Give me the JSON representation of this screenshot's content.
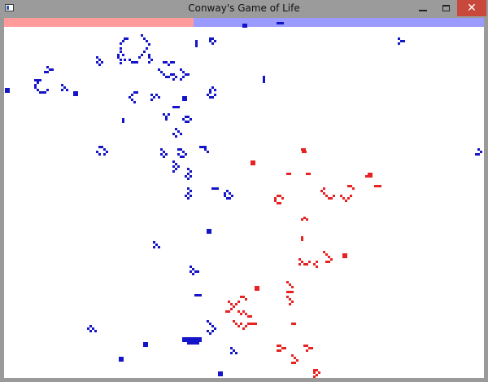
{
  "window": {
    "title": "Conway's Game of Life",
    "icon": "app-icon",
    "controls": [
      "minimize-icon",
      "maximize-icon",
      "close-icon"
    ]
  },
  "colors": {
    "red_team": "#e62222",
    "blue_team": "#1414c8",
    "red_bar": "#ff9b9b",
    "blue_bar": "#9b9bff",
    "background": "#ffffff",
    "titlebar": "#9b9b9b",
    "close_button": "#c9483c"
  },
  "population": {
    "red_fraction": 0.395,
    "blue_fraction": 0.605
  },
  "board": {
    "cell_size": 3,
    "red_cells": [
      [
        370,
        182
      ],
      [
        373,
        182
      ],
      [
        371,
        185
      ],
      [
        374,
        185
      ],
      [
        308,
        197
      ],
      [
        311,
        197
      ],
      [
        308,
        200
      ],
      [
        311,
        200
      ],
      [
        352,
        212
      ],
      [
        355,
        212
      ],
      [
        376,
        212
      ],
      [
        379,
        212
      ],
      [
        452,
        212
      ],
      [
        455,
        212
      ],
      [
        449,
        215
      ],
      [
        452,
        215
      ],
      [
        455,
        215
      ],
      [
        427,
        227
      ],
      [
        430,
        227
      ],
      [
        433,
        230
      ],
      [
        460,
        227
      ],
      [
        463,
        227
      ],
      [
        466,
        227
      ],
      [
        397,
        230
      ],
      [
        394,
        233
      ],
      [
        397,
        236
      ],
      [
        400,
        239
      ],
      [
        403,
        242
      ],
      [
        406,
        242
      ],
      [
        409,
        239
      ],
      [
        418,
        239
      ],
      [
        421,
        242
      ],
      [
        424,
        245
      ],
      [
        427,
        242
      ],
      [
        430,
        239
      ],
      [
        337,
        242
      ],
      [
        340,
        239
      ],
      [
        343,
        239
      ],
      [
        346,
        242
      ],
      [
        343,
        248
      ],
      [
        340,
        248
      ],
      [
        337,
        245
      ],
      [
        370,
        268
      ],
      [
        373,
        266
      ],
      [
        376,
        268
      ],
      [
        370,
        290
      ],
      [
        370,
        293
      ],
      [
        397,
        308
      ],
      [
        400,
        311
      ],
      [
        403,
        314
      ],
      [
        406,
        317
      ],
      [
        403,
        320
      ],
      [
        400,
        320
      ],
      [
        421,
        311
      ],
      [
        424,
        311
      ],
      [
        421,
        314
      ],
      [
        424,
        314
      ],
      [
        367,
        317
      ],
      [
        370,
        320
      ],
      [
        367,
        323
      ],
      [
        373,
        323
      ],
      [
        376,
        323
      ],
      [
        379,
        320
      ],
      [
        388,
        320
      ],
      [
        385,
        323
      ],
      [
        388,
        326
      ],
      [
        313,
        351
      ],
      [
        316,
        351
      ],
      [
        313,
        354
      ],
      [
        316,
        354
      ],
      [
        352,
        345
      ],
      [
        355,
        348
      ],
      [
        358,
        351
      ],
      [
        352,
        357
      ],
      [
        355,
        357
      ],
      [
        358,
        357
      ],
      [
        352,
        363
      ],
      [
        355,
        366
      ],
      [
        358,
        369
      ],
      [
        355,
        372
      ],
      [
        295,
        363
      ],
      [
        298,
        363
      ],
      [
        301,
        366
      ],
      [
        280,
        369
      ],
      [
        283,
        372
      ],
      [
        286,
        375
      ],
      [
        289,
        372
      ],
      [
        292,
        369
      ],
      [
        283,
        378
      ],
      [
        277,
        381
      ],
      [
        280,
        381
      ],
      [
        292,
        381
      ],
      [
        295,
        384
      ],
      [
        298,
        381
      ],
      [
        301,
        384
      ],
      [
        304,
        387
      ],
      [
        307,
        387
      ],
      [
        286,
        393
      ],
      [
        289,
        396
      ],
      [
        292,
        399
      ],
      [
        295,
        396
      ],
      [
        298,
        402
      ],
      [
        301,
        399
      ],
      [
        304,
        396
      ],
      [
        307,
        396
      ],
      [
        310,
        396
      ],
      [
        313,
        396
      ],
      [
        358,
        396
      ],
      [
        361,
        396
      ],
      [
        340,
        423
      ],
      [
        343,
        423
      ],
      [
        346,
        426
      ],
      [
        349,
        426
      ],
      [
        343,
        429
      ],
      [
        340,
        429
      ],
      [
        373,
        423
      ],
      [
        376,
        423
      ],
      [
        379,
        426
      ],
      [
        382,
        426
      ],
      [
        376,
        429
      ],
      [
        358,
        435
      ],
      [
        361,
        438
      ],
      [
        364,
        441
      ],
      [
        361,
        444
      ],
      [
        358,
        444
      ],
      [
        385,
        453
      ],
      [
        388,
        453
      ],
      [
        385,
        456
      ],
      [
        388,
        459
      ],
      [
        391,
        456
      ],
      [
        385,
        461
      ]
    ],
    "blue_cells": [
      [
        298,
        29
      ],
      [
        301,
        29
      ],
      [
        298,
        31
      ],
      [
        301,
        31
      ],
      [
        340,
        27
      ],
      [
        343,
        27
      ],
      [
        346,
        27
      ],
      [
        489,
        46
      ],
      [
        492,
        49
      ],
      [
        495,
        49
      ],
      [
        489,
        52
      ],
      [
        257,
        46
      ],
      [
        260,
        46
      ],
      [
        263,
        49
      ],
      [
        257,
        49
      ],
      [
        260,
        52
      ],
      [
        240,
        49
      ],
      [
        240,
        52
      ],
      [
        240,
        55
      ],
      [
        173,
        42
      ],
      [
        176,
        46
      ],
      [
        179,
        49
      ],
      [
        182,
        53
      ],
      [
        179,
        58
      ],
      [
        176,
        62
      ],
      [
        173,
        66
      ],
      [
        170,
        69
      ],
      [
        152,
        46
      ],
      [
        155,
        46
      ],
      [
        150,
        49
      ],
      [
        147,
        52
      ],
      [
        147,
        58
      ],
      [
        147,
        62
      ],
      [
        150,
        66
      ],
      [
        147,
        72
      ],
      [
        152,
        72
      ],
      [
        158,
        72
      ],
      [
        161,
        75
      ],
      [
        164,
        75
      ],
      [
        167,
        75
      ],
      [
        144,
        66
      ],
      [
        144,
        69
      ],
      [
        147,
        76
      ],
      [
        182,
        66
      ],
      [
        182,
        69
      ],
      [
        182,
        75
      ],
      [
        185,
        72
      ],
      [
        118,
        69
      ],
      [
        121,
        72
      ],
      [
        124,
        75
      ],
      [
        121,
        78
      ],
      [
        118,
        75
      ],
      [
        200,
        75
      ],
      [
        203,
        75
      ],
      [
        206,
        78
      ],
      [
        209,
        75
      ],
      [
        212,
        75
      ],
      [
        194,
        84
      ],
      [
        197,
        87
      ],
      [
        200,
        90
      ],
      [
        203,
        93
      ],
      [
        206,
        93
      ],
      [
        209,
        90
      ],
      [
        212,
        90
      ],
      [
        215,
        93
      ],
      [
        212,
        96
      ],
      [
        221,
        84
      ],
      [
        224,
        87
      ],
      [
        227,
        90
      ],
      [
        224,
        93
      ],
      [
        221,
        96
      ],
      [
        230,
        90
      ],
      [
        57,
        81
      ],
      [
        60,
        84
      ],
      [
        63,
        84
      ],
      [
        57,
        87
      ],
      [
        54,
        87
      ],
      [
        6,
        108
      ],
      [
        9,
        108
      ],
      [
        6,
        111
      ],
      [
        9,
        111
      ],
      [
        42,
        97
      ],
      [
        45,
        97
      ],
      [
        48,
        97
      ],
      [
        45,
        100
      ],
      [
        42,
        103
      ],
      [
        42,
        106
      ],
      [
        45,
        109
      ],
      [
        48,
        112
      ],
      [
        51,
        112
      ],
      [
        54,
        112
      ],
      [
        57,
        109
      ],
      [
        75,
        103
      ],
      [
        78,
        106
      ],
      [
        81,
        109
      ],
      [
        75,
        109
      ],
      [
        90,
        112
      ],
      [
        93,
        112
      ],
      [
        90,
        115
      ],
      [
        93,
        115
      ],
      [
        323,
        93
      ],
      [
        323,
        96
      ],
      [
        323,
        99
      ],
      [
        257,
        109
      ],
      [
        260,
        106
      ],
      [
        263,
        109
      ],
      [
        257,
        112
      ],
      [
        254,
        115
      ],
      [
        257,
        118
      ],
      [
        260,
        118
      ],
      [
        263,
        115
      ],
      [
        164,
        112
      ],
      [
        167,
        112
      ],
      [
        161,
        115
      ],
      [
        158,
        118
      ],
      [
        161,
        121
      ],
      [
        164,
        124
      ],
      [
        185,
        115
      ],
      [
        188,
        118
      ],
      [
        191,
        115
      ],
      [
        194,
        118
      ],
      [
        185,
        121
      ],
      [
        224,
        118
      ],
      [
        227,
        118
      ],
      [
        224,
        121
      ],
      [
        227,
        121
      ],
      [
        212,
        130
      ],
      [
        215,
        130
      ],
      [
        218,
        130
      ],
      [
        200,
        139
      ],
      [
        203,
        142
      ],
      [
        206,
        139
      ],
      [
        203,
        145
      ],
      [
        227,
        142
      ],
      [
        230,
        142
      ],
      [
        233,
        145
      ],
      [
        230,
        148
      ],
      [
        227,
        148
      ],
      [
        224,
        145
      ],
      [
        150,
        145
      ],
      [
        150,
        148
      ],
      [
        215,
        157
      ],
      [
        218,
        160
      ],
      [
        212,
        163
      ],
      [
        215,
        166
      ],
      [
        221,
        163
      ],
      [
        121,
        179
      ],
      [
        124,
        179
      ],
      [
        127,
        182
      ],
      [
        130,
        185
      ],
      [
        127,
        188
      ],
      [
        121,
        188
      ],
      [
        118,
        185
      ],
      [
        197,
        182
      ],
      [
        200,
        185
      ],
      [
        203,
        188
      ],
      [
        197,
        188
      ],
      [
        200,
        191
      ],
      [
        218,
        182
      ],
      [
        221,
        182
      ],
      [
        224,
        185
      ],
      [
        227,
        188
      ],
      [
        224,
        191
      ],
      [
        221,
        191
      ],
      [
        218,
        188
      ],
      [
        245,
        179
      ],
      [
        248,
        179
      ],
      [
        251,
        182
      ],
      [
        254,
        185
      ],
      [
        251,
        179
      ],
      [
        587,
        182
      ],
      [
        590,
        185
      ],
      [
        587,
        188
      ],
      [
        584,
        188
      ],
      [
        212,
        197
      ],
      [
        215,
        200
      ],
      [
        218,
        203
      ],
      [
        212,
        203
      ],
      [
        215,
        206
      ],
      [
        212,
        209
      ],
      [
        230,
        206
      ],
      [
        233,
        209
      ],
      [
        230,
        212
      ],
      [
        227,
        215
      ],
      [
        230,
        218
      ],
      [
        233,
        215
      ],
      [
        260,
        230
      ],
      [
        263,
        230
      ],
      [
        266,
        230
      ],
      [
        230,
        230
      ],
      [
        233,
        233
      ],
      [
        230,
        236
      ],
      [
        227,
        239
      ],
      [
        230,
        242
      ],
      [
        233,
        239
      ],
      [
        275,
        236
      ],
      [
        278,
        233
      ],
      [
        281,
        236
      ],
      [
        284,
        239
      ],
      [
        281,
        242
      ],
      [
        278,
        242
      ],
      [
        275,
        239
      ],
      [
        254,
        281
      ],
      [
        257,
        281
      ],
      [
        254,
        284
      ],
      [
        257,
        284
      ],
      [
        188,
        296
      ],
      [
        191,
        299
      ],
      [
        194,
        302
      ],
      [
        188,
        302
      ],
      [
        233,
        326
      ],
      [
        236,
        329
      ],
      [
        239,
        332
      ],
      [
        236,
        335
      ],
      [
        233,
        332
      ],
      [
        242,
        332
      ],
      [
        239,
        361
      ],
      [
        242,
        361
      ],
      [
        245,
        361
      ],
      [
        254,
        393
      ],
      [
        257,
        396
      ],
      [
        260,
        399
      ],
      [
        263,
        402
      ],
      [
        260,
        405
      ],
      [
        257,
        408
      ],
      [
        254,
        405
      ],
      [
        110,
        399
      ],
      [
        113,
        402
      ],
      [
        116,
        405
      ],
      [
        110,
        405
      ],
      [
        107,
        402
      ],
      [
        224,
        414
      ],
      [
        227,
        414
      ],
      [
        230,
        414
      ],
      [
        233,
        414
      ],
      [
        236,
        414
      ],
      [
        239,
        414
      ],
      [
        242,
        414
      ],
      [
        245,
        414
      ],
      [
        224,
        417
      ],
      [
        227,
        417
      ],
      [
        230,
        417
      ],
      [
        233,
        417
      ],
      [
        236,
        417
      ],
      [
        239,
        417
      ],
      [
        242,
        417
      ],
      [
        245,
        417
      ],
      [
        230,
        420
      ],
      [
        233,
        420
      ],
      [
        236,
        420
      ],
      [
        239,
        420
      ],
      [
        242,
        420
      ],
      [
        176,
        420
      ],
      [
        179,
        420
      ],
      [
        176,
        423
      ],
      [
        179,
        423
      ],
      [
        283,
        426
      ],
      [
        286,
        429
      ],
      [
        289,
        432
      ],
      [
        283,
        432
      ],
      [
        146,
        438
      ],
      [
        149,
        438
      ],
      [
        146,
        441
      ],
      [
        149,
        441
      ],
      [
        268,
        456
      ],
      [
        271,
        456
      ],
      [
        268,
        459
      ],
      [
        271,
        459
      ]
    ]
  }
}
